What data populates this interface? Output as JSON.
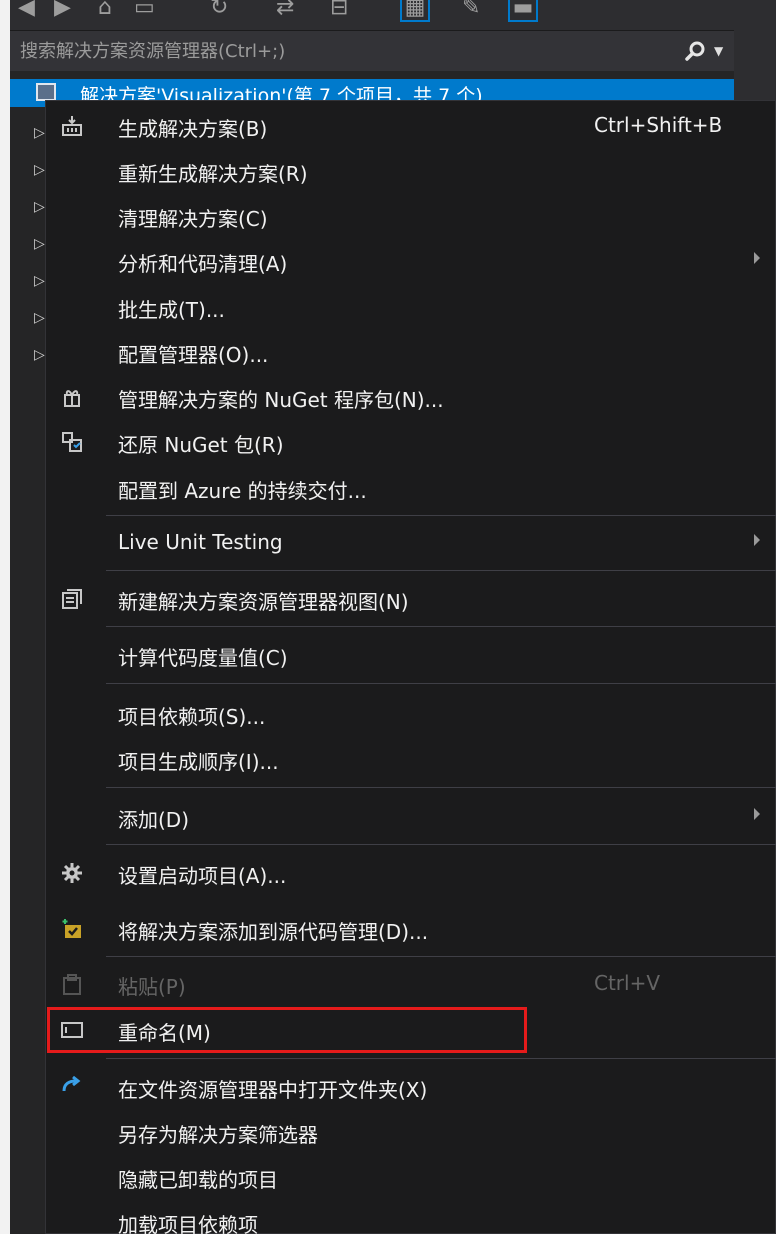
{
  "search": {
    "placeholder": "搜索解决方案资源管理器(Ctrl+;)"
  },
  "tree": {
    "selected_label": "解决方案'Visualization'(第 7 个项目，共 7 个)"
  },
  "icons": {
    "toolbar": [
      "back-icon",
      "forward-icon",
      "home-icon",
      "switch-views-icon",
      "history-icon",
      "sync-icon",
      "collapse-icon",
      "show-all-files-icon",
      "properties-icon",
      "preview-icon"
    ],
    "search": "search-icon",
    "dropdown": "chevron-down-icon"
  },
  "colors": {
    "accent": "#007acc",
    "highlight_border": "#e51b1b",
    "menu_bg": "#1b1b1c",
    "text": "#f1f1f1",
    "disabled": "#656565"
  },
  "menu": {
    "build": "生成解决方案(B)",
    "build_shortcut": "Ctrl+Shift+B",
    "rebuild": "重新生成解决方案(R)",
    "clean": "清理解决方案(C)",
    "analyze": "分析和代码清理(A)",
    "batch_build": "批生成(T)...",
    "config_manager": "配置管理器(O)...",
    "manage_nuget": "管理解决方案的 NuGet 程序包(N)...",
    "restore_nuget": "还原 NuGet 包(R)",
    "azure_delivery": "配置到 Azure 的持续交付...",
    "live_unit_testing": "Live Unit Testing",
    "new_explorer_view": "新建解决方案资源管理器视图(N)",
    "code_metrics": "计算代码度量值(C)",
    "project_dependencies": "项目依赖项(S)...",
    "build_order": "项目生成顺序(I)...",
    "add": "添加(D)",
    "startup_projects": "设置启动项目(A)...",
    "add_source_control": "将解决方案添加到源代码管理(D)...",
    "paste": "粘贴(P)",
    "paste_shortcut": "Ctrl+V",
    "rename": "重命名(M)",
    "open_folder": "在文件资源管理器中打开文件夹(X)",
    "save_filter": "另存为解决方案筛选器",
    "hide_unloaded": "隐藏已卸载的项目",
    "load_dependencies": "加载项目依赖项"
  }
}
